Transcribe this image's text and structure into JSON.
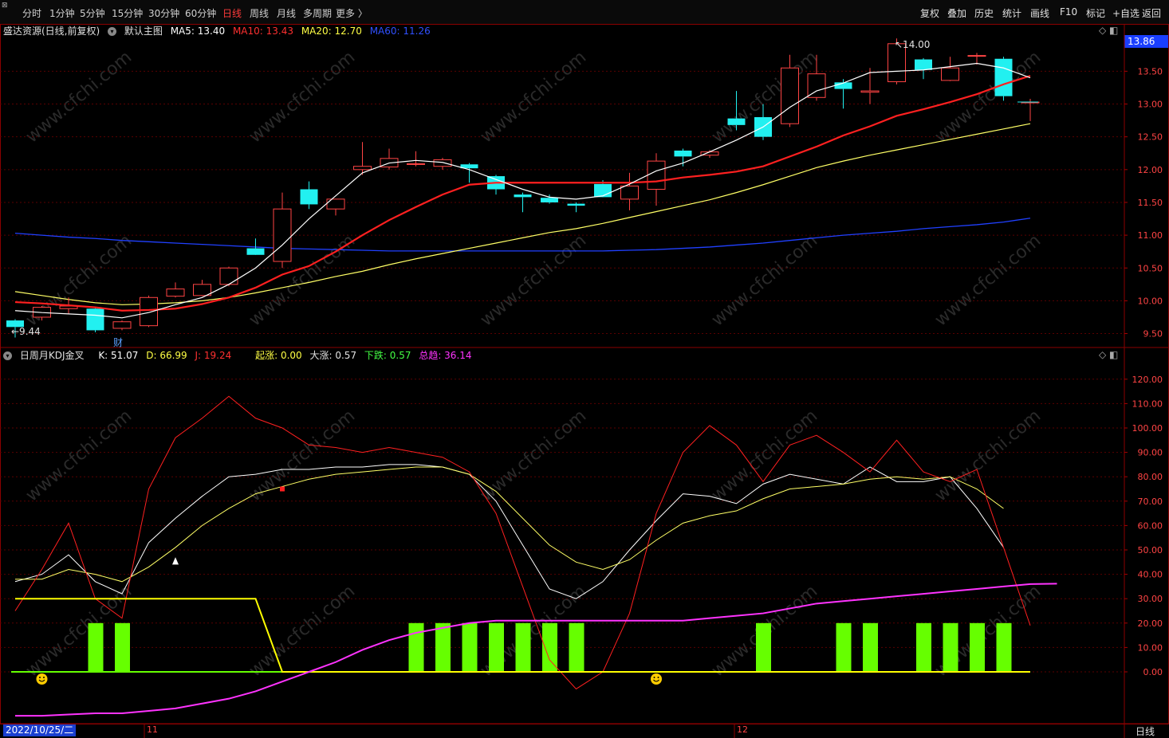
{
  "toolbar": {
    "periods": [
      "分时",
      "1分钟",
      "5分钟",
      "15分钟",
      "30分钟",
      "60分钟",
      "日线",
      "周线",
      "月线",
      "多周期",
      "更多 〉"
    ],
    "active_period": "日线",
    "tools": [
      "复权",
      "叠加",
      "历史",
      "统计",
      "画线",
      "F10",
      "标记",
      "+自选",
      "返回"
    ]
  },
  "main_header": {
    "stock": "盛达资源(日线,前复权)",
    "template": "默认主图",
    "ma5": "MA5: 13.40",
    "ma10": "MA10: 13.43",
    "ma20": "MA20: 12.70",
    "ma60": "MA60: 11.26"
  },
  "sub_header": {
    "indicator": "日周月KDJ金叉",
    "k": "K: 51.07",
    "d": "D: 66.99",
    "j": "J: 19.24",
    "qizhang": "起涨: 0.00",
    "dazhang": "大涨: 0.57",
    "xiadie": "下跌: 0.57",
    "zongqu": "总趋: 36.14"
  },
  "annotations": {
    "high": "14.00",
    "low": "9.44",
    "cai": "财",
    "current_price": "13.86"
  },
  "x_axis": {
    "date": "2022/10/25/二",
    "month11": "11",
    "month12": "12",
    "period": "日线"
  },
  "watermark": "www.cfchi.com",
  "colors": {
    "up": "#ff4444",
    "down": "#22f0f0",
    "ma5": "#ffffff",
    "ma10": "#ff2020",
    "ma20": "#ffff66",
    "ma60": "#2040ff",
    "magenta": "#ff33ff",
    "green": "#66ff00"
  },
  "chart_data": [
    {
      "type": "candlestick",
      "title": "盛达资源(日线,前复权)",
      "ylim": [
        9.3,
        14.1
      ],
      "yticks": [
        "9.50",
        "10.00",
        "10.50",
        "11.00",
        "11.50",
        "12.00",
        "12.50",
        "13.00",
        "13.50"
      ],
      "candles": [
        {
          "o": 9.7,
          "h": 9.72,
          "l": 9.44,
          "c": 9.6
        },
        {
          "o": 9.75,
          "h": 9.92,
          "l": 9.7,
          "c": 9.9
        },
        {
          "o": 9.88,
          "h": 10.05,
          "l": 9.8,
          "c": 9.92
        },
        {
          "o": 9.88,
          "h": 9.9,
          "l": 9.52,
          "c": 9.55
        },
        {
          "o": 9.58,
          "h": 9.7,
          "l": 9.55,
          "c": 9.68
        },
        {
          "o": 9.62,
          "h": 10.08,
          "l": 9.6,
          "c": 10.05
        },
        {
          "o": 10.07,
          "h": 10.28,
          "l": 10.05,
          "c": 10.18
        },
        {
          "o": 10.08,
          "h": 10.32,
          "l": 10.07,
          "c": 10.25
        },
        {
          "o": 10.25,
          "h": 10.52,
          "l": 10.22,
          "c": 10.5
        },
        {
          "o": 10.8,
          "h": 10.95,
          "l": 10.75,
          "c": 10.7
        },
        {
          "o": 10.6,
          "h": 11.65,
          "l": 10.5,
          "c": 11.4
        },
        {
          "o": 11.7,
          "h": 11.82,
          "l": 11.4,
          "c": 11.47
        },
        {
          "o": 11.4,
          "h": 11.55,
          "l": 11.3,
          "c": 11.55
        },
        {
          "o": 12.0,
          "h": 12.42,
          "l": 11.92,
          "c": 12.05
        },
        {
          "o": 12.04,
          "h": 12.32,
          "l": 12.0,
          "c": 12.17
        },
        {
          "o": 12.08,
          "h": 12.28,
          "l": 12.05,
          "c": 12.09
        },
        {
          "o": 12.05,
          "h": 12.18,
          "l": 12.0,
          "c": 12.15
        },
        {
          "o": 12.08,
          "h": 12.1,
          "l": 11.8,
          "c": 12.02
        },
        {
          "o": 11.9,
          "h": 11.92,
          "l": 11.62,
          "c": 11.7
        },
        {
          "o": 11.62,
          "h": 11.65,
          "l": 11.35,
          "c": 11.58
        },
        {
          "o": 11.57,
          "h": 11.62,
          "l": 11.48,
          "c": 11.5
        },
        {
          "o": 11.48,
          "h": 11.5,
          "l": 11.35,
          "c": 11.45
        },
        {
          "o": 11.78,
          "h": 11.84,
          "l": 11.6,
          "c": 11.58
        },
        {
          "o": 11.55,
          "h": 11.95,
          "l": 11.38,
          "c": 11.75
        },
        {
          "o": 11.7,
          "h": 12.25,
          "l": 11.45,
          "c": 12.13
        },
        {
          "o": 12.29,
          "h": 12.32,
          "l": 12.05,
          "c": 12.2
        },
        {
          "o": 12.22,
          "h": 12.3,
          "l": 12.18,
          "c": 12.27
        },
        {
          "o": 12.78,
          "h": 13.2,
          "l": 12.6,
          "c": 12.68
        },
        {
          "o": 12.8,
          "h": 13.0,
          "l": 12.45,
          "c": 12.5
        },
        {
          "o": 12.7,
          "h": 13.75,
          "l": 12.65,
          "c": 13.55
        },
        {
          "o": 13.1,
          "h": 13.75,
          "l": 13.05,
          "c": 13.46
        },
        {
          "o": 13.33,
          "h": 13.38,
          "l": 12.93,
          "c": 13.23
        },
        {
          "o": 13.18,
          "h": 13.55,
          "l": 13.0,
          "c": 13.2
        },
        {
          "o": 13.34,
          "h": 14.0,
          "l": 13.3,
          "c": 13.92
        },
        {
          "o": 13.68,
          "h": 13.7,
          "l": 13.38,
          "c": 13.52
        },
        {
          "o": 13.36,
          "h": 13.72,
          "l": 13.35,
          "c": 13.55
        },
        {
          "o": 13.74,
          "h": 13.78,
          "l": 13.6,
          "c": 13.74
        },
        {
          "o": 13.69,
          "h": 13.72,
          "l": 13.05,
          "c": 13.12
        },
        {
          "o": 13.02,
          "h": 13.08,
          "l": 12.74,
          "c": 13.03
        }
      ],
      "ma5": [
        9.85,
        9.82,
        9.8,
        9.78,
        9.74,
        9.82,
        9.94,
        10.05,
        10.25,
        10.5,
        10.85,
        11.25,
        11.6,
        11.95,
        12.1,
        12.14,
        12.11,
        12.0,
        11.85,
        11.7,
        11.58,
        11.55,
        11.6,
        11.78,
        11.98,
        12.1,
        12.27,
        12.45,
        12.65,
        12.95,
        13.2,
        13.32,
        13.48,
        13.5,
        13.52,
        13.57,
        13.62,
        13.55,
        13.4
      ],
      "ma10": [
        9.98,
        9.96,
        9.93,
        9.9,
        9.85,
        9.86,
        9.88,
        9.95,
        10.05,
        10.2,
        10.4,
        10.53,
        10.75,
        11.0,
        11.23,
        11.43,
        11.62,
        11.77,
        11.8,
        11.8,
        11.8,
        11.8,
        11.8,
        11.8,
        11.82,
        11.88,
        11.92,
        11.97,
        12.05,
        12.2,
        12.35,
        12.52,
        12.66,
        12.82,
        12.92,
        13.03,
        13.15,
        13.3,
        13.43
      ],
      "ma20": [
        10.14,
        10.08,
        10.02,
        9.97,
        9.94,
        9.95,
        9.97,
        10.0,
        10.05,
        10.12,
        10.2,
        10.28,
        10.37,
        10.45,
        10.55,
        10.64,
        10.72,
        10.8,
        10.88,
        10.96,
        11.04,
        11.1,
        11.18,
        11.27,
        11.36,
        11.45,
        11.54,
        11.65,
        11.77,
        11.9,
        12.03,
        12.13,
        12.22,
        12.3,
        12.38,
        12.46,
        12.54,
        12.62,
        12.7
      ],
      "ma60": [
        11.03,
        11.0,
        10.97,
        10.95,
        10.92,
        10.9,
        10.88,
        10.86,
        10.84,
        10.82,
        10.8,
        10.79,
        10.78,
        10.77,
        10.76,
        10.76,
        10.76,
        10.76,
        10.76,
        10.76,
        10.76,
        10.76,
        10.76,
        10.77,
        10.78,
        10.8,
        10.82,
        10.85,
        10.88,
        10.92,
        10.96,
        11.0,
        11.03,
        11.06,
        11.1,
        11.13,
        11.16,
        11.2,
        11.26
      ]
    },
    {
      "type": "line",
      "title": "日周月KDJ金叉",
      "ylim": [
        -20,
        125
      ],
      "yticks": [
        "0.00",
        "10.00",
        "20.00",
        "30.00",
        "40.00",
        "50.00",
        "60.00",
        "70.00",
        "80.00",
        "90.00",
        "100.00",
        "110.00",
        "120.00"
      ],
      "series": [
        {
          "name": "K",
          "values": [
            37,
            40,
            48,
            37,
            32,
            53,
            63,
            72,
            80,
            81,
            83,
            83,
            84,
            84,
            85,
            85,
            84,
            81,
            70,
            52,
            34,
            30,
            37,
            50,
            62,
            73,
            72,
            69,
            77,
            81,
            79,
            77,
            84,
            78,
            78,
            80,
            67,
            51
          ]
        },
        {
          "name": "D",
          "values": [
            38,
            38,
            42,
            40,
            37,
            43,
            51,
            60,
            67,
            73,
            76,
            79,
            81,
            82,
            83,
            84,
            84,
            81,
            74,
            63,
            52,
            45,
            42,
            46,
            54,
            61,
            64,
            66,
            71,
            75,
            76,
            77,
            79,
            80,
            79,
            80,
            75,
            67
          ]
        },
        {
          "name": "J",
          "values": [
            25,
            42,
            61,
            30,
            22,
            75,
            96,
            104,
            113,
            104,
            100,
            93,
            92,
            90,
            92,
            90,
            88,
            82,
            65,
            35,
            5,
            -7,
            0,
            24,
            65,
            90,
            101,
            93,
            78,
            93,
            97,
            90,
            82,
            95,
            82,
            78,
            83,
            51,
            19
          ]
        },
        {
          "name": "起涨",
          "values": [
            30,
            30,
            30,
            30,
            30,
            30,
            30,
            30,
            30,
            30,
            0,
            0,
            0,
            0,
            0,
            0,
            0,
            0,
            0,
            0,
            0,
            0,
            0,
            0,
            0,
            0,
            0,
            0,
            0,
            0,
            0,
            0,
            0,
            0,
            0,
            0,
            0,
            0,
            0
          ]
        },
        {
          "name": "总趋",
          "values": [
            -18,
            -18,
            -17.5,
            -17,
            -17,
            -16,
            -15,
            -13,
            -11,
            -8,
            -4,
            0,
            4,
            9,
            13,
            16,
            18,
            20,
            21,
            21,
            21,
            21,
            21,
            21,
            21,
            21,
            22,
            23,
            24,
            26,
            28,
            29,
            30,
            31,
            32,
            33,
            34,
            35,
            36,
            36.14
          ]
        }
      ],
      "bars": [
        0,
        0,
        0,
        1,
        1,
        0,
        0,
        0,
        0,
        0,
        0,
        0,
        0,
        0,
        0,
        1,
        1,
        1,
        1,
        1,
        1,
        1,
        0,
        0,
        0,
        0,
        0,
        0,
        1,
        0,
        0,
        1,
        1,
        0,
        1,
        1,
        1,
        1,
        0
      ],
      "bar_height": 20
    }
  ]
}
